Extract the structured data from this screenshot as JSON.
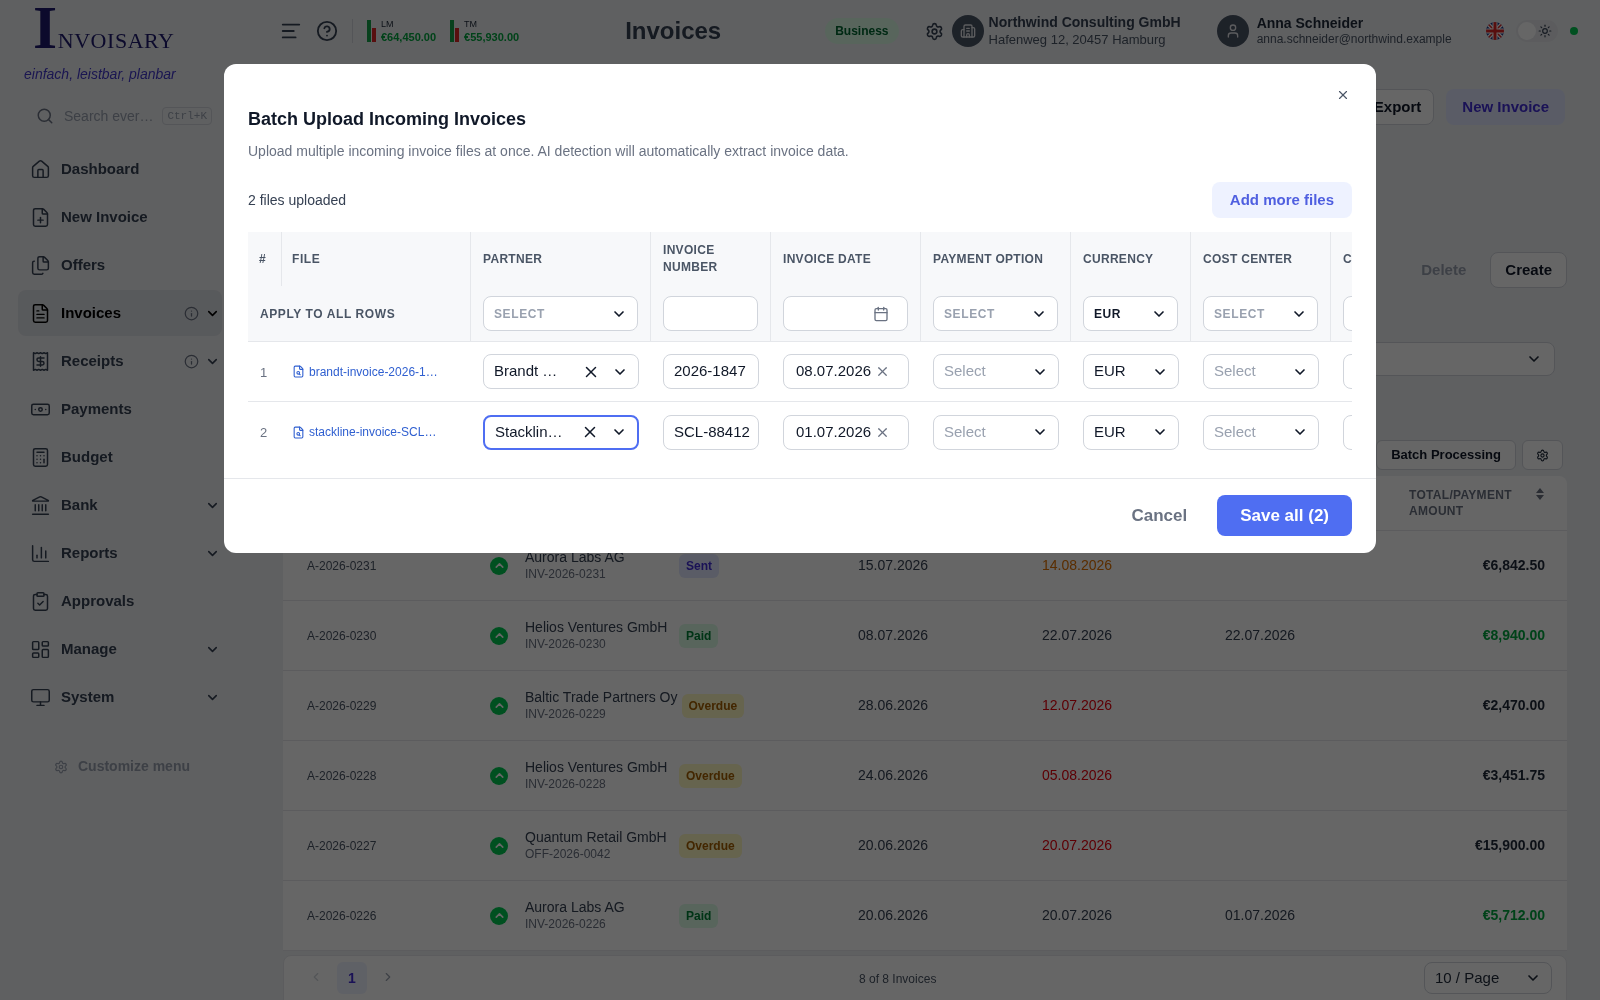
{
  "sidebar": {
    "logo": "INVOISARY",
    "tagline": "einfach, leistbar, planbar",
    "search": {
      "placeholder": "Search ever…",
      "shortcut": "Ctrl+K"
    },
    "items": [
      {
        "label": "Dashboard",
        "selected": false,
        "info": false,
        "submenu": false
      },
      {
        "label": "New Invoice",
        "selected": false,
        "info": false,
        "submenu": false
      },
      {
        "label": "Offers",
        "selected": false,
        "info": false,
        "submenu": false
      },
      {
        "label": "Invoices",
        "selected": true,
        "info": true,
        "submenu": true
      },
      {
        "label": "Receipts",
        "selected": false,
        "info": true,
        "submenu": true
      },
      {
        "label": "Payments",
        "selected": false,
        "info": false,
        "submenu": false
      },
      {
        "label": "Budget",
        "selected": false,
        "info": false,
        "submenu": false
      },
      {
        "label": "Bank",
        "selected": false,
        "info": false,
        "submenu": true
      },
      {
        "label": "Reports",
        "selected": false,
        "info": false,
        "submenu": true
      },
      {
        "label": "Approvals",
        "selected": false,
        "info": false,
        "submenu": false
      },
      {
        "label": "Manage",
        "selected": false,
        "info": false,
        "submenu": true
      },
      {
        "label": "System",
        "selected": false,
        "info": false,
        "submenu": true
      }
    ],
    "customize": "Customize menu"
  },
  "topbar": {
    "stats": [
      {
        "label": "LM",
        "value": "€64,450.00"
      },
      {
        "label": "TM",
        "value": "€55,930.00"
      }
    ],
    "title": "Invoices",
    "plan": "Business",
    "company": {
      "name": "Northwind Consulting GmbH",
      "address": "Hafenweg 12, 20457 Hamburg"
    },
    "user": {
      "name": "Anna Schneider",
      "email": "anna.schneider@northwind.example"
    },
    "dark_mode": false,
    "online": true
  },
  "page": {
    "actions": [
      {
        "label": "Export",
        "kind": "secondary"
      },
      {
        "label": "New Invoice",
        "kind": "primary"
      }
    ],
    "bulk_actions": [
      {
        "label": "Delete",
        "disabled": true
      },
      {
        "label": "Create",
        "disabled": false
      }
    ],
    "batch_button": "Batch Processing",
    "amount_header": "TOTAL/PAYMENT AMOUNT",
    "rows": [
      {
        "ref": "A-2026-0231",
        "partner": "Aurora Labs AG",
        "document": "INV-2026-0231",
        "status": {
          "label": "Sent",
          "kind": "sent"
        },
        "date": "15.07.2026",
        "due": "14.08.2026",
        "amount": "€6,842.50"
      },
      {
        "ref": "A-2026-0230",
        "partner": "Helios Ventures GmbH",
        "document": "INV-2026-0230",
        "status": {
          "label": "Paid",
          "kind": "paid"
        },
        "date": "08.07.2026",
        "due": "22.07.2026",
        "paid": "22.07.2026",
        "amount": "€8,940.00"
      },
      {
        "ref": "A-2026-0229",
        "partner": "Baltic Trade Partners Oy",
        "document": "INV-2026-0229",
        "status": {
          "label": "Overdue",
          "kind": "overdue"
        },
        "date": "28.06.2026",
        "due": "12.07.2026",
        "amount": "€2,470.00"
      },
      {
        "ref": "A-2026-0228",
        "partner": "Helios Ventures GmbH",
        "document": "INV-2026-0228",
        "status": {
          "label": "Overdue",
          "kind": "overdue"
        },
        "date": "24.06.2026",
        "due": "05.08.2026",
        "amount": "€3,451.75"
      },
      {
        "ref": "A-2026-0227",
        "partner": "Quantum Retail GmbH",
        "document": "OFF-2026-0042",
        "status": {
          "label": "Overdue",
          "kind": "overdue"
        },
        "date": "20.06.2026",
        "due": "20.07.2026",
        "amount": "€15,900.00"
      },
      {
        "ref": "A-2026-0226",
        "partner": "Aurora Labs AG",
        "document": "INV-2026-0226",
        "status": {
          "label": "Paid",
          "kind": "paid"
        },
        "date": "20.06.2026",
        "due": "20.07.2026",
        "paid": "01.07.2026",
        "amount": "€5,712.00"
      }
    ],
    "pagination": {
      "page": "1",
      "summary": "8 of 8 Invoices",
      "page_size": "10 / Page"
    }
  },
  "dialog": {
    "title": "Batch Upload Incoming Invoices",
    "description": "Upload multiple incoming invoice files at once. AI detection will automatically extract invoice data.",
    "count": "2 files uploaded",
    "add_button": "Add more files",
    "columns": [
      "#",
      "FILE",
      "PARTNER",
      "INVOICE NUMBER",
      "INVOICE DATE",
      "PAYMENT OPTION",
      "CURRENCY",
      "COST CENTER",
      "C"
    ],
    "apply_all": {
      "label": "APPLY TO ALL ROWS",
      "partner": {
        "placeholder": "SELECT"
      },
      "payment_option": {
        "placeholder": "SELECT"
      },
      "currency": {
        "value": "EUR"
      },
      "cost_center": {
        "placeholder": "SELECT"
      }
    },
    "rows": [
      {
        "index": "1",
        "file": "brandt-invoice-2026-1…",
        "partner": {
          "value": "Brandt …",
          "focused": false
        },
        "invoice_number": "2026-1847",
        "invoice_date": "08.07.2026",
        "payment_option": {
          "placeholder": "Select"
        },
        "currency": {
          "value": "EUR"
        },
        "cost_center": {
          "placeholder": "Select"
        }
      },
      {
        "index": "2",
        "file": "stackline-invoice-SCL…",
        "partner": {
          "value": "Stacklin…",
          "focused": true
        },
        "invoice_number": "SCL-88412",
        "invoice_date": "01.07.2026",
        "payment_option": {
          "placeholder": "Select"
        },
        "currency": {
          "value": "EUR"
        },
        "cost_center": {
          "placeholder": "Select"
        }
      }
    ],
    "cancel": "Cancel",
    "save": "Save all (2)"
  }
}
